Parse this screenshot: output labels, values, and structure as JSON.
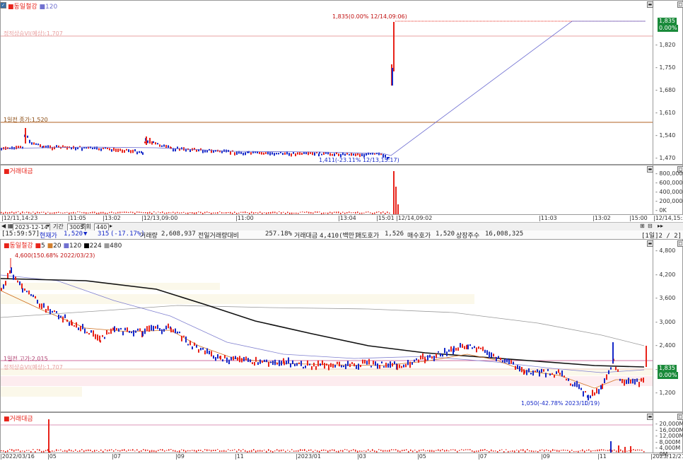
{
  "top_chart": {
    "legend_name": "동일철강",
    "legend_period": "120",
    "expected_limit_label": "정적상승VI(예상):1,707",
    "prev_close_label": "1일전 종가:1,520",
    "high_annotation": "1,835(0.00% 12/14,09:06)",
    "low_annotation": "1,411(-23.11% 12/13,15:17)",
    "price_ticks": [
      "1,820",
      "1,750",
      "1,680",
      "1,610",
      "1,540",
      "1,470"
    ],
    "last_price_tag": "1,835",
    "last_change_tag": "0.00%",
    "colors": {
      "up": "#e8231a",
      "down": "#1528c8",
      "ma": "#7070d0"
    }
  },
  "top_volume": {
    "legend": "거래대금",
    "ticks": [
      "800,000K",
      "600,000K",
      "400,000K",
      "200,000K",
      "0K"
    ]
  },
  "top_time_axis": [
    "12/11,14:23",
    "11:05",
    "13:02",
    "12/13,09:00",
    "11:00",
    "13:04",
    "15:01",
    "12/14,09:02",
    "11:03",
    "13:02",
    "15:00",
    "12/14,15:35"
  ],
  "toolbar": {
    "date": "2023-12-14",
    "period_label": "기간",
    "period_value": "3005",
    "lookup_label": "조회",
    "count_value": "440"
  },
  "quote_bar": {
    "time": "15:59:57",
    "current_label": "현재가",
    "price": "1,520",
    "change": "315",
    "change_pct": "(-17.17%)",
    "volume_label": "거래량",
    "volume": "2,608,937",
    "prev_ratio_label": "전일거래량대비",
    "prev_ratio": "257.18%",
    "amount_label": "거래대금",
    "amount": "4,410(백만)",
    "ask_label": "매도호가",
    "ask": "1,526",
    "bid_label": "매수호가",
    "bid": "1,520",
    "shares_label": "상장주수",
    "shares": "16,008,325",
    "page_info": "1일",
    "page_num": "2 / 2"
  },
  "bottom_chart": {
    "legend_name": "동일철강",
    "ma_list": [
      "5",
      "20",
      "120",
      "224",
      "480"
    ],
    "high_annotation": "4,600(150.68% 2022/03/23)",
    "low_annotation": "1,050(-42.78% 2023/10/19)",
    "prev_high_label": "1일전 고가:2,015",
    "expected_limit_label": "정적상승VI(예상):1,707",
    "price_ticks": [
      "4,800",
      "4,200",
      "3,600",
      "3,000",
      "2,400",
      "1,800",
      "1,200"
    ],
    "last_price_tag": "1,835",
    "last_change_tag": "0.00%"
  },
  "bottom_volume": {
    "legend": "거래대금",
    "ticks": [
      "20,000M",
      "16,000M",
      "12,000M",
      "8,000M",
      "4,000M",
      "0M"
    ]
  },
  "bottom_time_axis": [
    "2022/03/16",
    "05",
    "07",
    "09",
    "11",
    "2023/01",
    "03",
    "05",
    "07",
    "09",
    "11",
    "2023/12/21"
  ]
}
